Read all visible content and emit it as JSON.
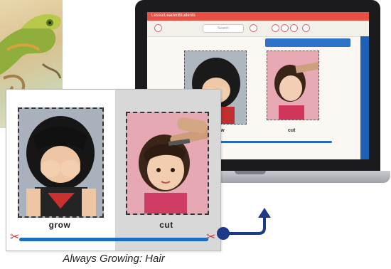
{
  "screen": {
    "topbar_items": [
      "Lesson",
      "Leaders",
      "Students"
    ],
    "search_placeholder": "Search",
    "words": [
      "grow",
      "cut"
    ]
  },
  "worksheet": {
    "cards": [
      {
        "label": "grow"
      },
      {
        "label": "cut"
      }
    ]
  },
  "caption": "Always Growing: Hair",
  "colors": {
    "accent_blue": "#1d6bbd",
    "scissor_red": "#d63030",
    "screen_header_red": "#e94f43"
  }
}
